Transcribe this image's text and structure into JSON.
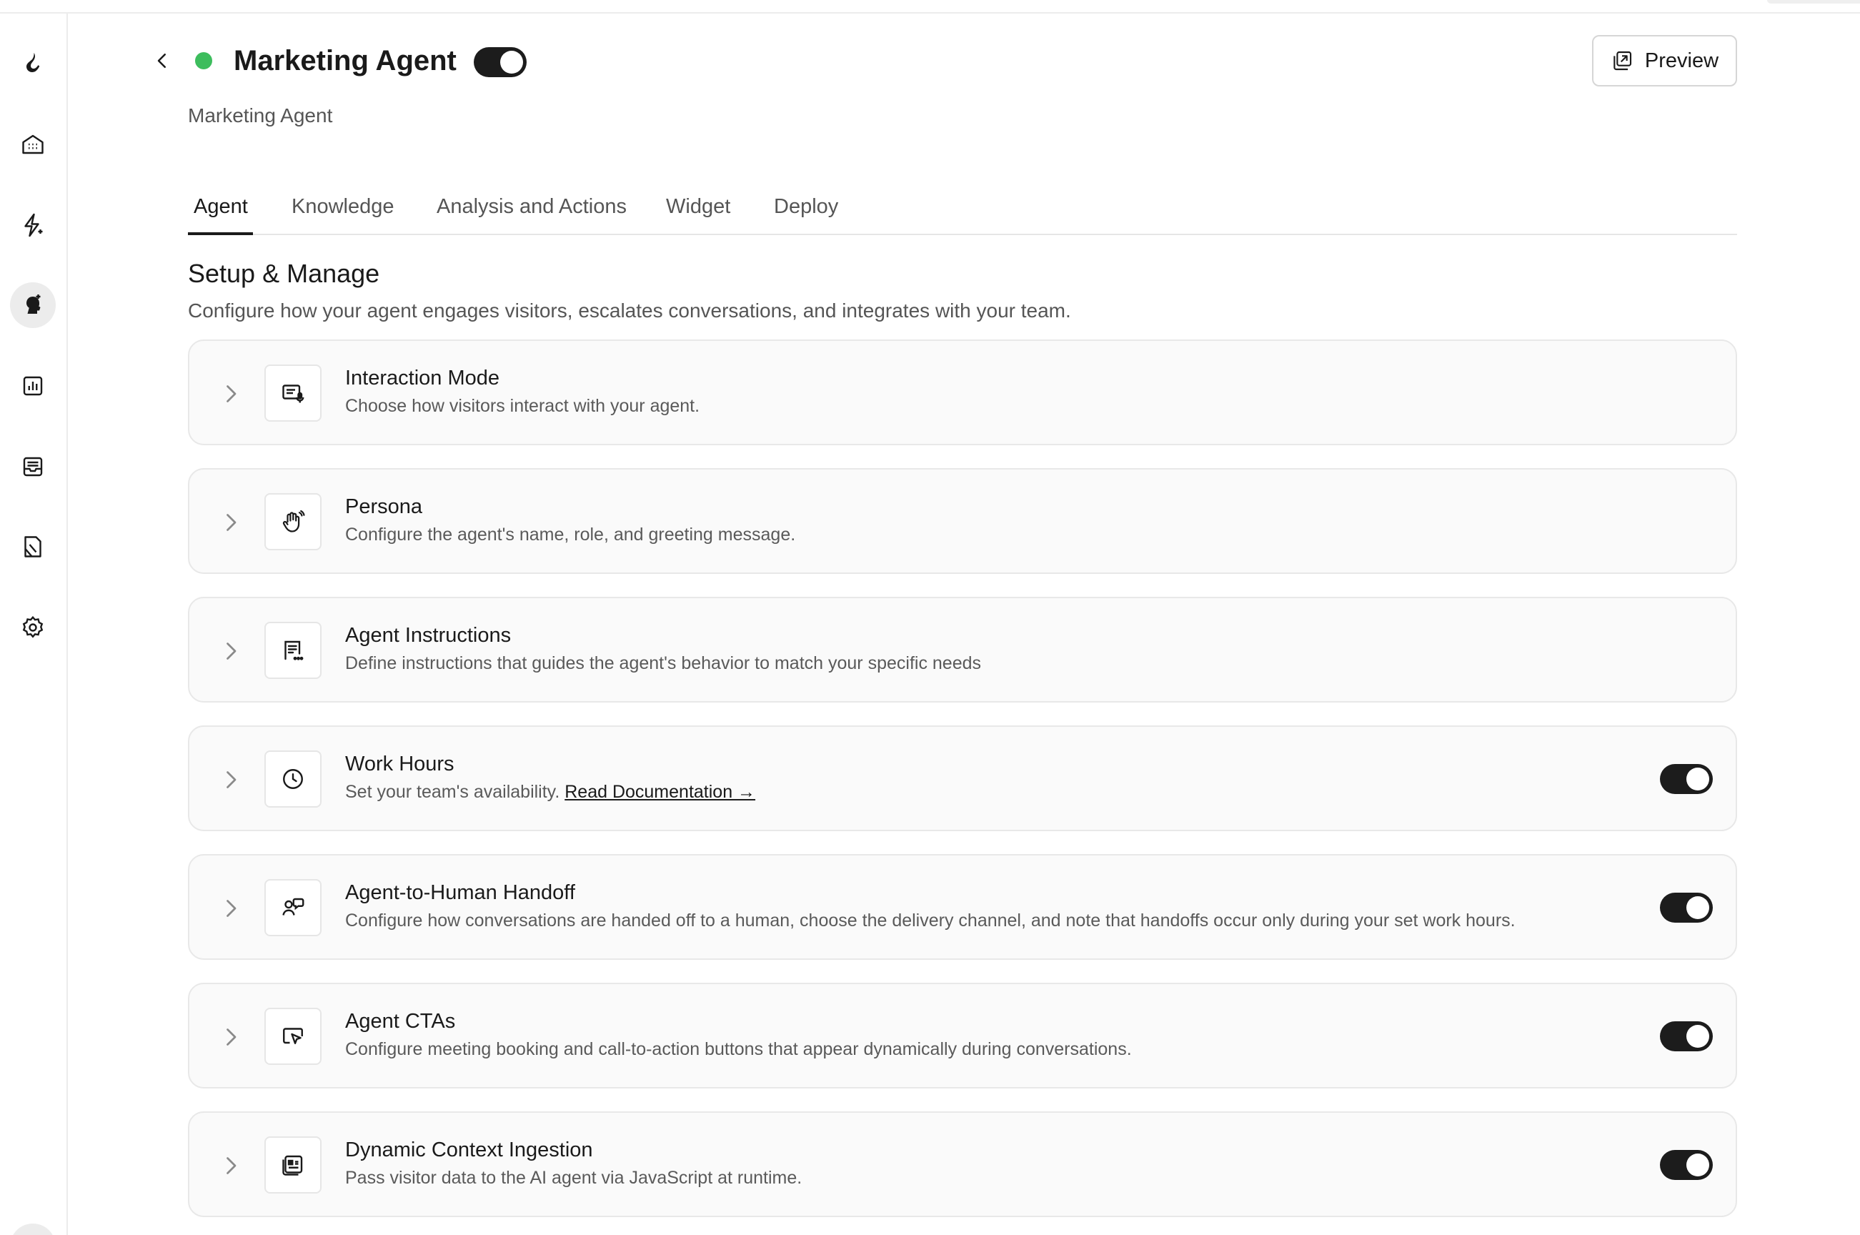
{
  "header": {
    "title": "Marketing Agent",
    "subtitle": "Marketing Agent",
    "status": "online",
    "agent_enabled": true,
    "preview_label": "Preview"
  },
  "sidebar": {
    "items": [
      {
        "icon": "logo-icon"
      },
      {
        "icon": "home-icon"
      },
      {
        "icon": "sparkle-bolt-icon"
      },
      {
        "icon": "agent-icon",
        "active": true
      },
      {
        "icon": "analytics-icon"
      },
      {
        "icon": "inbox-icon"
      },
      {
        "icon": "document-icon"
      },
      {
        "icon": "gear-icon"
      }
    ]
  },
  "tabs": [
    {
      "label": "Agent",
      "active": true
    },
    {
      "label": "Knowledge"
    },
    {
      "label": "Analysis and Actions"
    },
    {
      "label": "Widget"
    },
    {
      "label": "Deploy"
    }
  ],
  "section": {
    "title": "Setup & Manage",
    "description": "Configure how your agent engages visitors, escalates conversations, and integrates with your team."
  },
  "cards": [
    {
      "title": "Interaction Mode",
      "description": "Choose how visitors interact with your agent.",
      "icon": "chat-mic-icon"
    },
    {
      "title": "Persona",
      "description": "Configure the agent's name, role, and greeting message.",
      "icon": "waving-hand-icon"
    },
    {
      "title": "Agent Instructions",
      "description": "Define instructions that guides the agent's behavior to match your specific needs",
      "icon": "instructions-icon"
    },
    {
      "title": "Work Hours",
      "description": "Set your team's availability.",
      "link": "Read Documentation →",
      "icon": "clock-icon",
      "enabled": true
    },
    {
      "title": "Agent-to-Human Handoff",
      "description": "Configure how conversations are handed off to a human, choose the delivery channel, and note that handoffs occur only during your set work hours.",
      "icon": "handoff-icon",
      "enabled": true
    },
    {
      "title": "Agent CTAs",
      "description": "Configure meeting booking and call-to-action buttons that appear dynamically during conversations.",
      "icon": "cursor-click-icon",
      "enabled": true
    },
    {
      "title": "Dynamic Context Ingestion",
      "description": "Pass visitor data to the AI agent via JavaScript at runtime.",
      "icon": "context-card-icon",
      "enabled": true
    }
  ],
  "colors": {
    "status_green": "#3dbd5d",
    "toggle_on": "#1c1c1c",
    "card_bg": "#fafafa",
    "border": "#e8e8e8"
  }
}
